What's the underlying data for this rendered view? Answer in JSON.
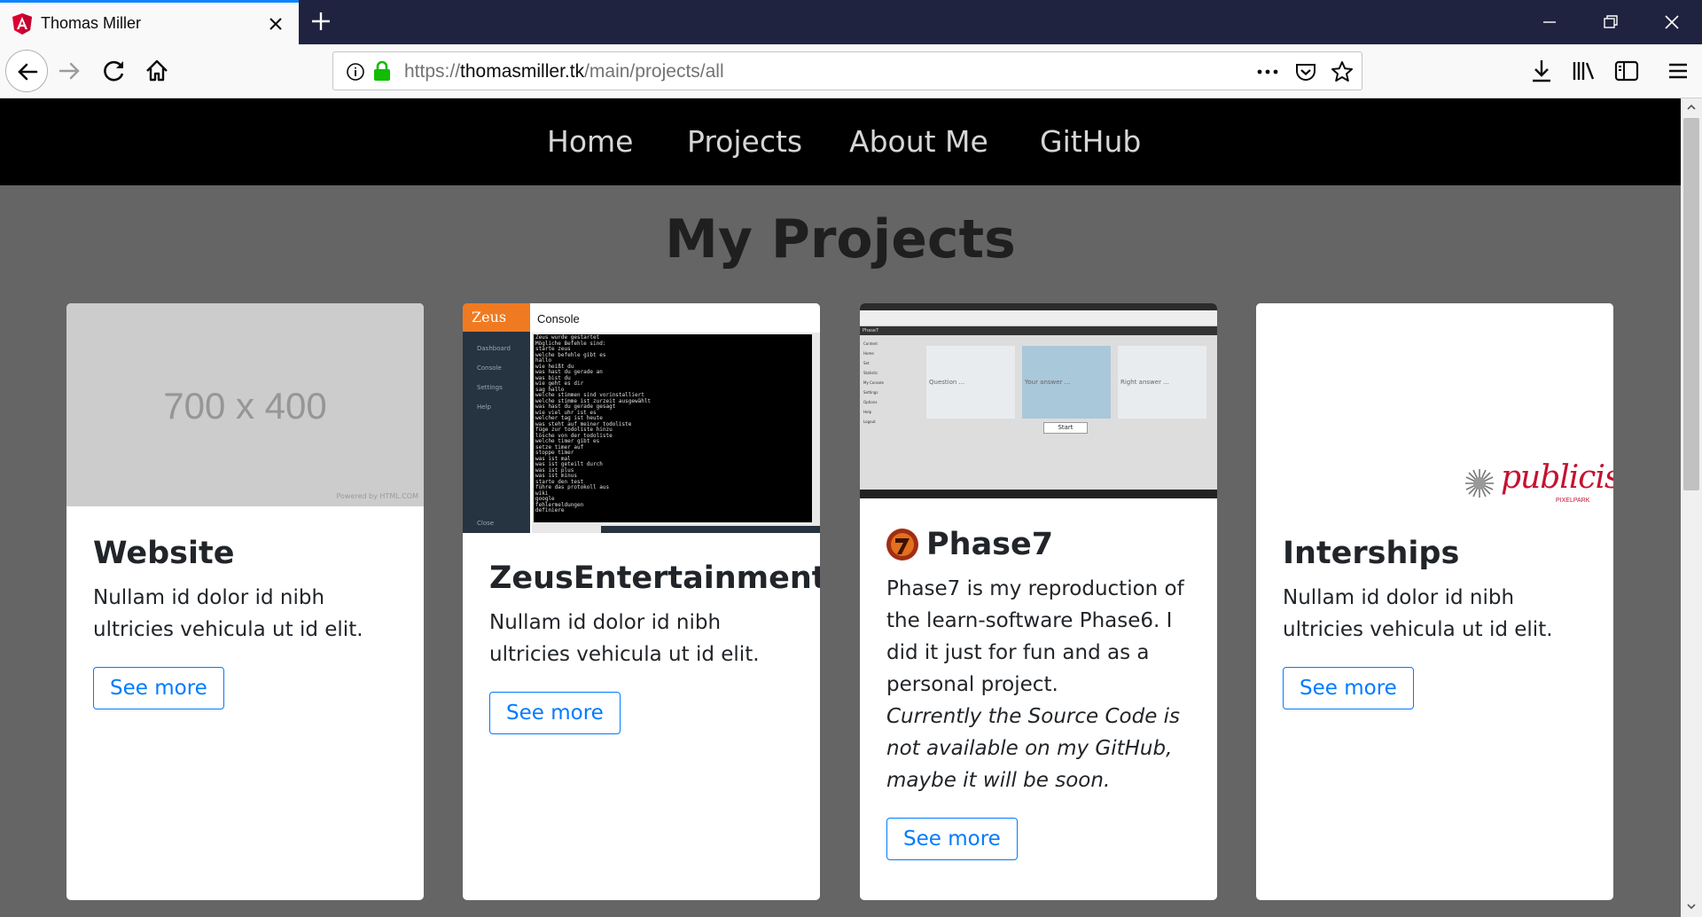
{
  "browser": {
    "tab_title": "Thomas Miller",
    "url_prefix": "https://",
    "url_host": "thomasmiller.tk",
    "url_path": "/main/projects/all"
  },
  "nav": {
    "home": "Home",
    "projects": "Projects",
    "about": "About Me",
    "github": "GitHub"
  },
  "page": {
    "title": "My Projects"
  },
  "cards": [
    {
      "title": "Website",
      "text": "Nullam id dolor id nibh ultricies vehicula ut id elit.",
      "button": "See more",
      "placeholder_label": "700 x 400",
      "placeholder_credit": "Powered by HTML.COM"
    },
    {
      "title": "ZeusEntertainment",
      "text": "Nullam id dolor id nibh ultricies vehicula ut id elit.",
      "button": "See more",
      "shot_brand": "Zeus",
      "shot_header": "Console",
      "shot_menu": [
        "Dashboard",
        "Console",
        "Settings",
        "Help"
      ],
      "shot_close": "Close",
      "shot_lines": [
        "Zeus wurde gestartet",
        "Mögliche Befehle sind:",
        "starte zeus",
        "welche befehle gibt es",
        "hallo",
        "wie heißt du",
        "was hast du gerade an",
        "was bist du",
        "wie geht es dir",
        "sag hallo",
        "welche stimmen sind vorinstalliert",
        "welche stimme ist zurzeit ausgewählt",
        "was hast du gerade gesagt",
        "wie viel uhr ist es",
        "welcher tag ist heute",
        "was steht auf meiner todoliste",
        "füge zur todoliste hinzu",
        "lösche von der todoliste",
        "welche timer gibt es",
        "setze timer auf",
        "stoppe timer",
        "was ist mal",
        "was ist geteilt durch",
        "was ist plus",
        "was ist minus",
        "starte den test",
        "führe das protokoll aus",
        "wiki",
        "google",
        "fehlermeldungen",
        "definiere"
      ]
    },
    {
      "title": "Phase7",
      "text": "Phase7 is my reproduction of the learn-software Phase6. I did it just for fun and as a personal project.",
      "note": "Currently the Source Code is not available on my GitHub, maybe it will be soon.",
      "button": "See more",
      "shot_app": "Phase7",
      "shot_menu": [
        "Content",
        "Home",
        "Set",
        "Statistic",
        "My Console",
        "Settings",
        "Options",
        "Help",
        "Logout"
      ],
      "shot_boxes": [
        "Question ...",
        "Your answer ...",
        "Right answer ..."
      ],
      "shot_start": "Start"
    },
    {
      "title": "Interships",
      "text": "Nullam id dolor id nibh ultricies vehicula ut id elit.",
      "button": "See more",
      "logo_text": "publicis",
      "logo_sub": "PIXELPARK"
    }
  ]
}
